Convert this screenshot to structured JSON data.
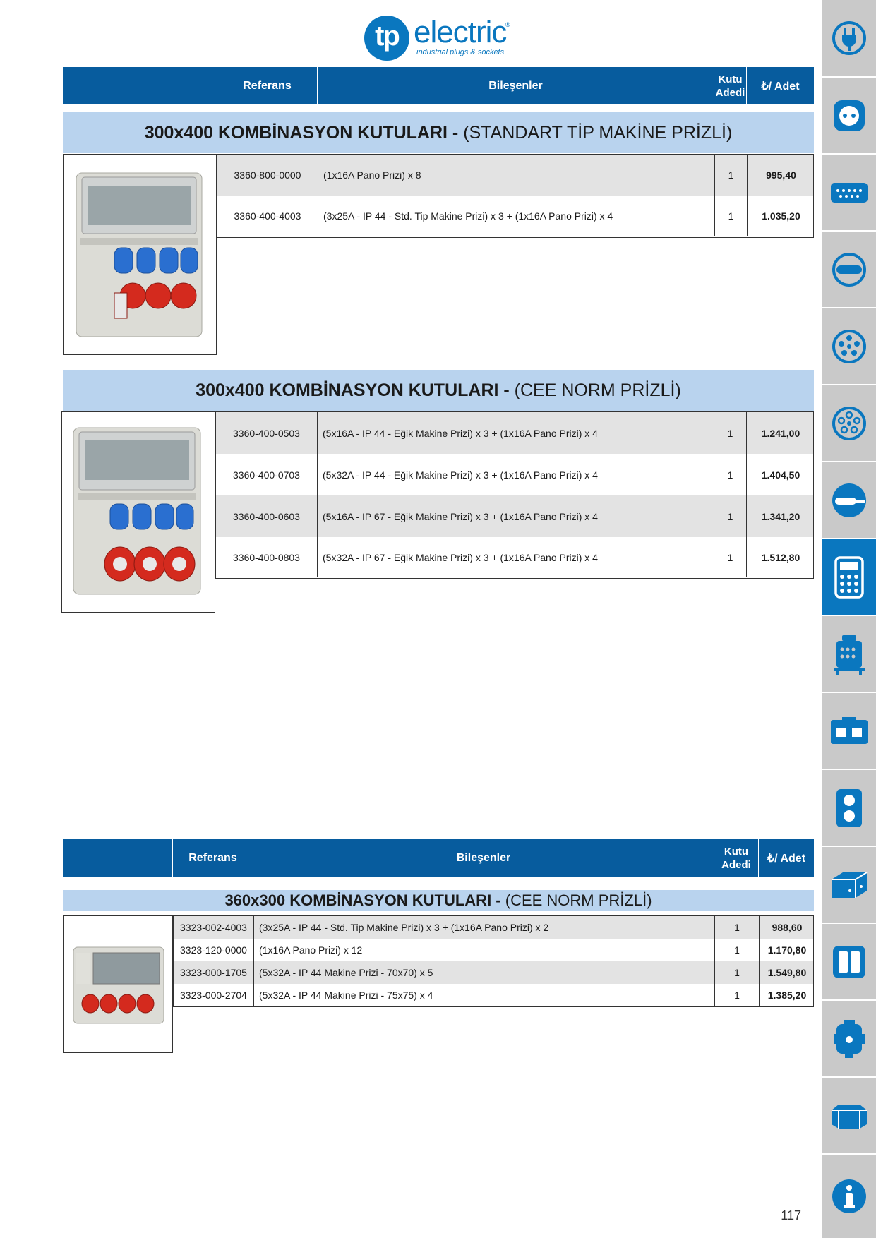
{
  "logo": {
    "brand_short": "tp",
    "brand_word": "electric",
    "registered": "®",
    "tagline": "industrial plugs & sockets"
  },
  "header1": {
    "col_referans": "Referans",
    "col_bilesenler": "Bileşenler",
    "col_kutu_line1": "Kutu",
    "col_kutu_line2": "Adedi",
    "col_price": "₺/ Adet"
  },
  "header2": {
    "col_referans": "Referans",
    "col_bilesenler": "Bileşenler",
    "col_kutu_line1": "Kutu",
    "col_kutu_line2": "Adedi",
    "col_price": "₺/ Adet"
  },
  "section1": {
    "title_bold": "300x400 KOMBİNASYON KUTULARI -",
    "title_light": "(STANDART TİP MAKİNE PRİZLİ)",
    "rows": [
      {
        "ref": "3360-800-0000",
        "desc": "(1x16A Pano Prizi) x 8",
        "qty": "1",
        "price": "995,40"
      },
      {
        "ref": "3360-400-4003",
        "desc": "(3x25A - IP 44 - Std. Tip Makine Prizi) x 3 + (1x16A Pano Prizi) x 4",
        "qty": "1",
        "price": "1.035,20"
      }
    ]
  },
  "section2": {
    "title_bold": "300x400 KOMBİNASYON KUTULARI -",
    "title_light": "(CEE NORM PRİZLİ)",
    "rows": [
      {
        "ref": "3360-400-0503",
        "desc": "(5x16A - IP 44 - Eğik Makine Prizi) x 3 + (1x16A Pano Prizi) x 4",
        "qty": "1",
        "price": "1.241,00"
      },
      {
        "ref": "3360-400-0703",
        "desc": "(5x32A - IP 44 - Eğik Makine Prizi) x 3 + (1x16A Pano Prizi) x 4",
        "qty": "1",
        "price": "1.404,50"
      },
      {
        "ref": "3360-400-0603",
        "desc": "(5x16A - IP 67 - Eğik Makine Prizi) x 3 + (1x16A Pano Prizi) x 4",
        "qty": "1",
        "price": "1.341,20"
      },
      {
        "ref": "3360-400-0803",
        "desc": "(5x32A - IP 67 - Eğik Makine Prizi) x 3 + (1x16A Pano Prizi) x 4",
        "qty": "1",
        "price": "1.512,80"
      }
    ]
  },
  "section3": {
    "title_bold": "360x300 KOMBİNASYON KUTULARI -",
    "title_light": "(CEE NORM PRİZLİ)",
    "rows": [
      {
        "ref": "3323-002-4003",
        "desc": "(3x25A - IP 44 - Std. Tip Makine Prizi) x 3 + (1x16A Pano Prizi) x 2",
        "qty": "1",
        "price": "988,60"
      },
      {
        "ref": "3323-120-0000",
        "desc": "(1x16A Pano Prizi) x 12",
        "qty": "1",
        "price": "1.170,80"
      },
      {
        "ref": "3323-000-1705",
        "desc": "(5x32A - IP 44 Makine Prizi - 70x70) x 5",
        "qty": "1",
        "price": "1.549,80"
      },
      {
        "ref": "3323-000-2704",
        "desc": "(5x32A - IP 44 Makine Prizi - 75x75) x 4",
        "qty": "1",
        "price": "1.385,20"
      }
    ]
  },
  "sidebar": {
    "tabs": [
      {
        "icon": "plug-icon"
      },
      {
        "icon": "socket-icon"
      },
      {
        "icon": "connector-strip-icon"
      },
      {
        "icon": "round-plug-icon"
      },
      {
        "icon": "multi-pin-socket-icon"
      },
      {
        "icon": "multi-pin-plug-icon"
      },
      {
        "icon": "cable-plug-icon"
      },
      {
        "icon": "combination-box-icon"
      },
      {
        "icon": "distribution-box-icon"
      },
      {
        "icon": "enclosure-icon"
      },
      {
        "icon": "double-socket-icon"
      },
      {
        "icon": "box-icon"
      },
      {
        "icon": "panel-icon"
      },
      {
        "icon": "cylinder-box-icon"
      },
      {
        "icon": "junction-box-icon"
      },
      {
        "icon": "info-icon"
      }
    ],
    "active_index": 6,
    "active_color": "#0a77bf",
    "inactive_color": "#c9c9c9"
  },
  "page_number": "117"
}
